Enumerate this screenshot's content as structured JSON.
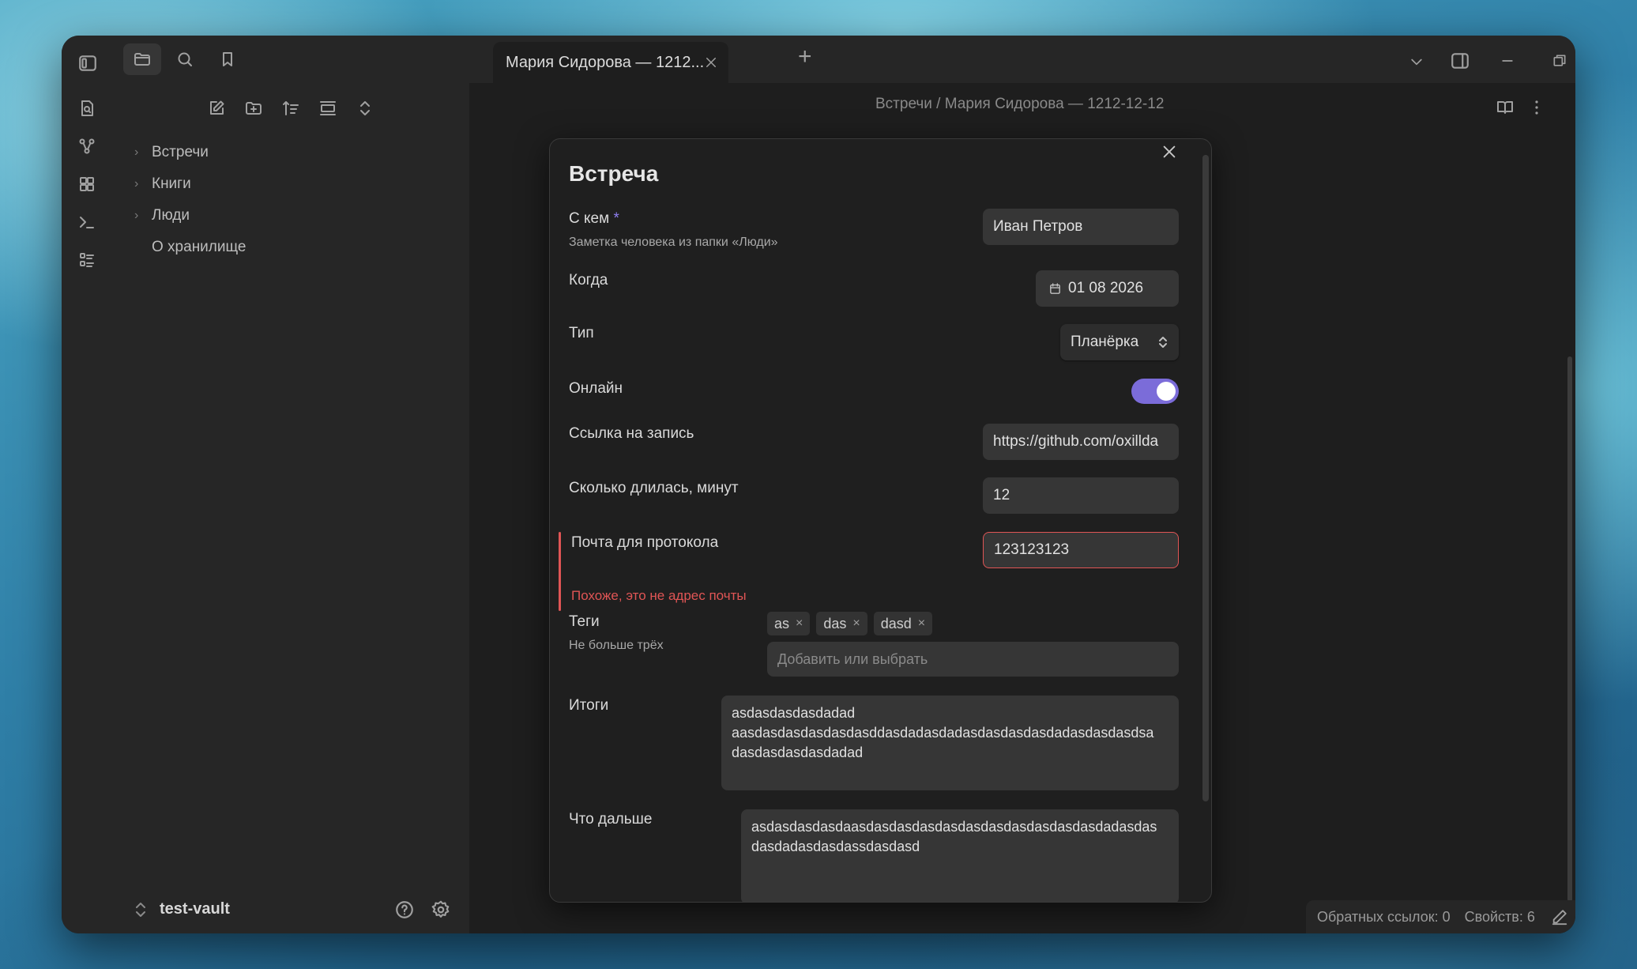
{
  "tab": {
    "title": "Мария Сидорова — 1212...",
    "new_tab": "+"
  },
  "breadcrumb": {
    "text": "Встречи / Мария Сидорова — 1212-12-12"
  },
  "tree": {
    "items": [
      {
        "label": "Встречи",
        "folder": true
      },
      {
        "label": "Книги",
        "folder": true
      },
      {
        "label": "Люди",
        "folder": true
      },
      {
        "label": "О хранилище",
        "folder": false
      }
    ]
  },
  "vault": {
    "name": "test-vault"
  },
  "modal": {
    "title": "Встреча",
    "with": {
      "label": "С кем",
      "required": "*",
      "desc": "Заметка человека из папки «Люди»",
      "value": "Иван Петров"
    },
    "when": {
      "label": "Когда",
      "value": "01 08 2026"
    },
    "type": {
      "label": "Тип",
      "value": "Планёрка"
    },
    "online": {
      "label": "Онлайн",
      "on": true
    },
    "link": {
      "label": "Ссылка на запись",
      "value": "https://github.com/oxilldа"
    },
    "duration": {
      "label": "Сколько длилась, минут",
      "value": "12"
    },
    "email": {
      "label": "Почта для протокола",
      "value": "123123123",
      "error": "Похоже, это не адрес почты"
    },
    "tags": {
      "label": "Теги",
      "desc": "Не больше трёх",
      "items": [
        "as",
        "das",
        "dasd"
      ],
      "remove": "×",
      "placeholder": "Добавить или выбрать"
    },
    "summary": {
      "label": "Итоги",
      "value": "asdasdasdasdadad\naasdasdasdasdasdasddasdadasdadasdasdasdasdadasdasdasdsa\ndasdasdasdasdadad"
    },
    "next": {
      "label": "Что дальше",
      "value": "asdasdasdasdaasdasdasdasdasdasdasdasdasdasdasdadasdas\ndasdadasdasdassdasdasd"
    }
  },
  "status": {
    "backlinks": "Обратных ссылок: 0",
    "properties": "Свойств: 6"
  },
  "colors": {
    "accent": "#7b6cd9",
    "error": "#e05555"
  }
}
